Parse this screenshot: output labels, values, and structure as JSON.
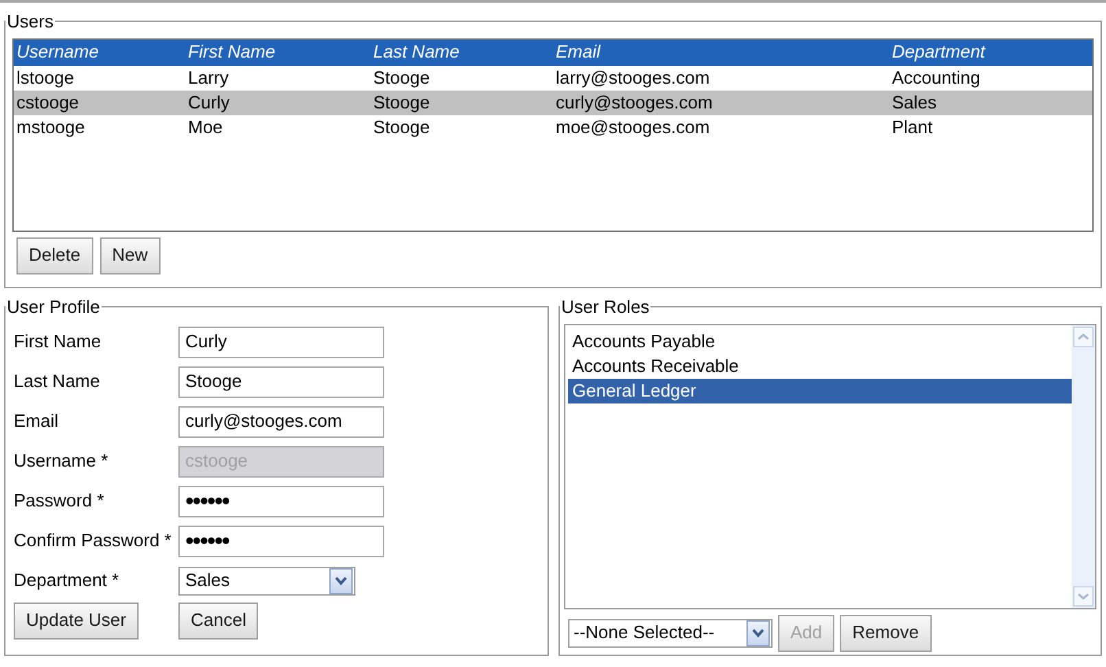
{
  "users": {
    "title": "Users",
    "columns": [
      "Username",
      "First Name",
      "Last Name",
      "Email",
      "Department"
    ],
    "rows": [
      {
        "cells": [
          "lstooge",
          "Larry",
          "Stooge",
          "larry@stooges.com",
          "Accounting"
        ],
        "selected": false
      },
      {
        "cells": [
          "cstooge",
          "Curly",
          "Stooge",
          "curly@stooges.com",
          "Sales"
        ],
        "selected": true
      },
      {
        "cells": [
          "mstooge",
          "Moe",
          "Stooge",
          "moe@stooges.com",
          "Plant"
        ],
        "selected": false
      }
    ],
    "buttons": [
      {
        "label": "Delete",
        "disabled": false
      },
      {
        "label": "New",
        "disabled": false
      }
    ]
  },
  "profile": {
    "title": "User Profile",
    "fields": [
      {
        "label": "First Name",
        "value": "Curly",
        "kind": "text"
      },
      {
        "label": "Last Name",
        "value": "Stooge",
        "kind": "text"
      },
      {
        "label": "Email",
        "value": "curly@stooges.com",
        "kind": "text"
      },
      {
        "label": "Username *",
        "value": "cstooge",
        "kind": "text",
        "disabled": true
      },
      {
        "label": "Password *",
        "value": "••••••",
        "kind": "password"
      },
      {
        "label": "Confirm Password *",
        "value": "••••••",
        "kind": "password"
      },
      {
        "label": "Department *",
        "value": "Sales",
        "kind": "select"
      }
    ],
    "buttons": [
      {
        "label": "Update User",
        "disabled": false
      },
      {
        "label": "Cancel",
        "disabled": false
      }
    ]
  },
  "roles": {
    "title": "User Roles",
    "items": [
      {
        "label": "Accounts Payable",
        "selected": false
      },
      {
        "label": "Accounts Receivable",
        "selected": false
      },
      {
        "label": "General Ledger",
        "selected": true
      }
    ],
    "select": {
      "value": "--None Selected--"
    },
    "buttons": [
      {
        "label": "Add",
        "disabled": true
      },
      {
        "label": "Remove",
        "disabled": false
      }
    ]
  }
}
